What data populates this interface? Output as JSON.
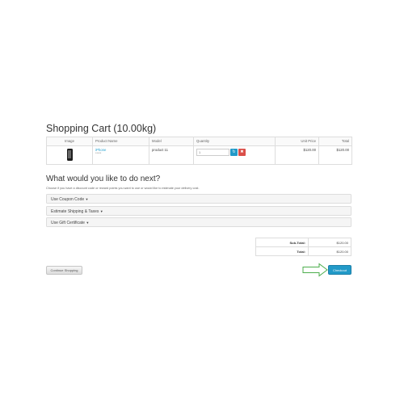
{
  "page": {
    "title": "Shopping Cart  (10.00kg)"
  },
  "cart": {
    "headers": [
      "Image",
      "Product Name",
      "Model",
      "Quantity",
      "Unit Price",
      "Total"
    ],
    "items": [
      {
        "image_icon": "phone-thumbnail",
        "name": "iPhone",
        "rating": "*****",
        "model": "product 11",
        "quantity": "1",
        "unit_price": "$120.00",
        "total": "$120.00"
      }
    ],
    "update_icon": "refresh-icon",
    "remove_icon": "times-circle-icon"
  },
  "next": {
    "title": "What would you like to do next?",
    "subtitle": "Choose if you have a discount code or reward points you want to use or would like to estimate your delivery cost.",
    "panels": [
      {
        "label": "Use Coupon Code"
      },
      {
        "label": "Estimate Shipping & Taxes"
      },
      {
        "label": "Use Gift Certificate"
      }
    ]
  },
  "totals": [
    {
      "label": "Sub-Total:",
      "value": "$120.00"
    },
    {
      "label": "Total:",
      "value": "$120.00"
    }
  ],
  "buttons": {
    "continue": "Continue Shopping",
    "checkout": "Checkout"
  },
  "colors": {
    "primary": "#229ac8",
    "danger": "#da4f49",
    "link": "#23a1d1",
    "arrow": "#4cae4c"
  }
}
